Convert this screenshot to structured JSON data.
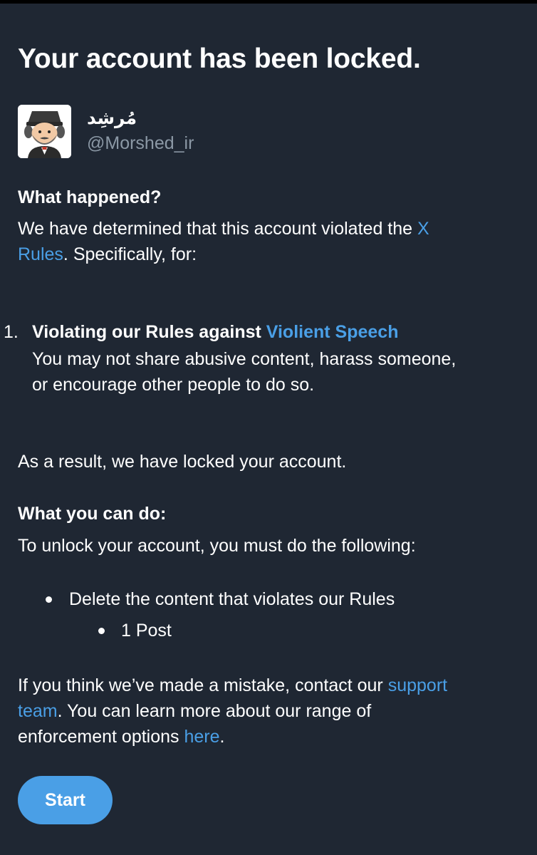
{
  "heading": "Your account has been locked.",
  "profile": {
    "display_name": "مُرشِد",
    "handle": "@Morshed_ir"
  },
  "what_happened": {
    "title": "What happened?",
    "text_line1_prefix": "We have determined that this account violated the ",
    "link_x": "X",
    "link_rules": "Rules",
    "text_line2_suffix": ". Specifically, for:"
  },
  "violation": {
    "number": "1.",
    "title_prefix": "Violating our Rules against ",
    "title_link": "Violient Speech",
    "desc_line1": "You may not share abusive content, harass someone,",
    "desc_line2": "or encourage other people to do so."
  },
  "result_text": "As a result, we have locked your account.",
  "what_you_can_do": {
    "title": "What you can do:",
    "text": "To unlock your account, you must do the following:",
    "item": "Delete the content that violates our Rules",
    "subitem": "1 Post"
  },
  "footer_text": {
    "line1_prefix": "If you think we’ve made a mistake, contact our ",
    "link_support": "support",
    "link_team": "team",
    "line2_suffix": ". You can learn more about our range of",
    "line3_prefix": "enforcement options ",
    "link_here": "here",
    "line3_suffix": "."
  },
  "start_button": "Start",
  "colors": {
    "background": "#1f2733",
    "link": "#4a9fe6",
    "secondary_text": "#8b98a5",
    "button": "#4a9fe6"
  }
}
